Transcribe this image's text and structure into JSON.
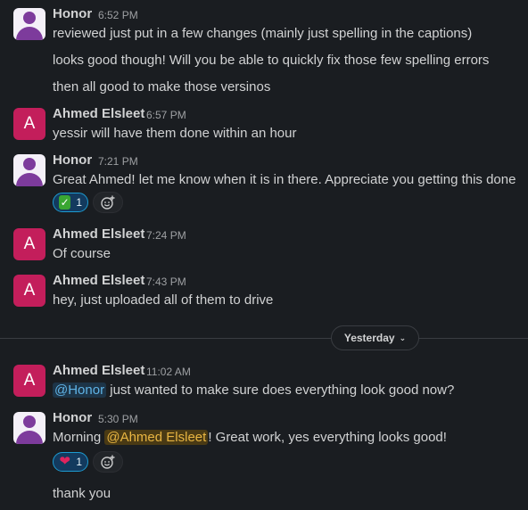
{
  "messages": [
    {
      "author": "Honor",
      "time": "6:52 PM",
      "lines": [
        "reviewed just put in a few changes (mainly just spelling in the captions)",
        "looks good though! Will you be able to quickly fix those few spelling errors",
        "then all good to make those versinos"
      ]
    },
    {
      "author": "Ahmed Elsleet",
      "avatar_letter": "A",
      "time": "6:57 PM",
      "lines": [
        "yessir will have them done within an hour"
      ]
    },
    {
      "author": "Honor",
      "time": "7:21 PM",
      "lines": [
        "Great Ahmed! let me know when it is in there. Appreciate you getting this done"
      ],
      "reaction": {
        "emoji": "white-check-mark",
        "count": "1"
      }
    },
    {
      "author": "Ahmed Elsleet",
      "avatar_letter": "A",
      "time": "7:24 PM",
      "lines": [
        "Of course"
      ]
    },
    {
      "author": "Ahmed Elsleet",
      "avatar_letter": "A",
      "time": "7:43 PM",
      "lines": [
        "hey, just uploaded all of them to drive"
      ]
    },
    {
      "author": "Ahmed Elsleet",
      "avatar_letter": "A",
      "time": "11:02 AM",
      "mention": "@Honor",
      "text_after": " just wanted to make sure does everything look good now?"
    },
    {
      "author": "Honor",
      "time": "5:30 PM",
      "text_before": "Morning ",
      "mention": "@Ahmed Elsleet",
      "text_after": "! Great work, yes everything looks good!",
      "reaction": {
        "emoji": "heart",
        "count": "1"
      },
      "extra_line": "thank you"
    }
  ],
  "date_divider": {
    "label": "Yesterday",
    "chevron": "chevron-down-icon"
  },
  "colors": {
    "background": "#1a1d21",
    "mention_bg": "#1d3447",
    "mention_self_bg": "#4a3a14",
    "reaction_active": "#1d9bd1",
    "avatar_red": "#c31e5b",
    "avatar_purple": "#7d3b9c"
  }
}
